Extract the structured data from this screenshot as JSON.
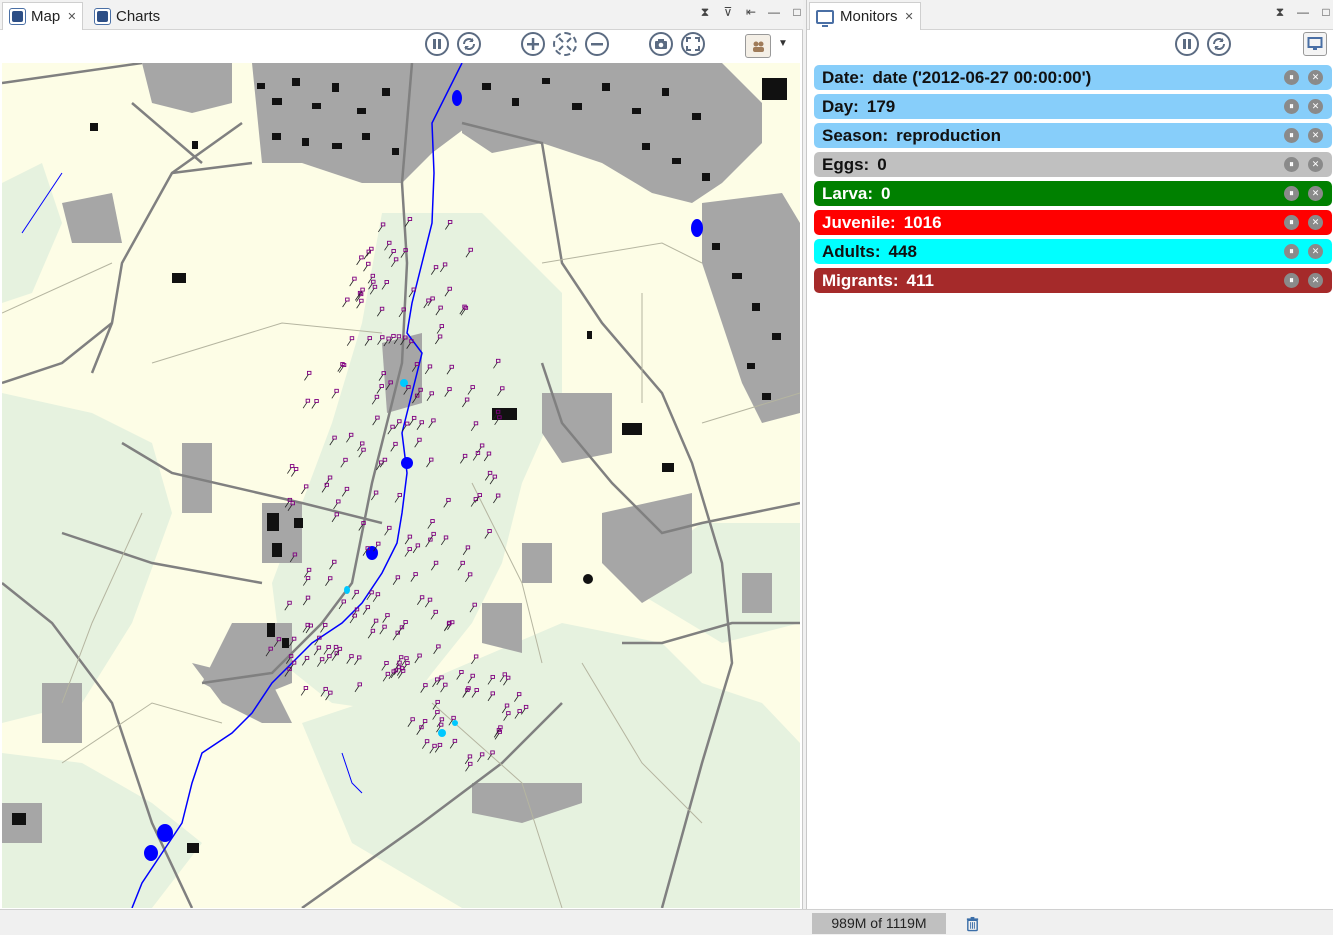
{
  "left_tabs": [
    {
      "label": "Map",
      "active": true,
      "closable": true
    },
    {
      "label": "Charts",
      "active": false,
      "closable": false
    }
  ],
  "right_tab": {
    "label": "Monitors"
  },
  "map_toolbar_icons": [
    "pause-icon",
    "sync-icon",
    "zoom-in-icon",
    "zoom-fit-icon",
    "zoom-out-icon",
    "camera-icon",
    "fullscreen-icon",
    "layers-icon"
  ],
  "monitors": [
    {
      "label": "Date:",
      "value": "date ('2012-06-27 00:00:00')",
      "bg": "#87cefa",
      "fg": "#111111"
    },
    {
      "label": "Day:",
      "value": "179",
      "bg": "#87cefa",
      "fg": "#111111"
    },
    {
      "label": "Season:",
      "value": "reproduction",
      "bg": "#87cefa",
      "fg": "#111111"
    },
    {
      "label": "Eggs:",
      "value": "0",
      "bg": "#c0c0c0",
      "fg": "#111111"
    },
    {
      "label": "Larva:",
      "value": "0",
      "bg": "#008000",
      "fg": "#ffffff"
    },
    {
      "label": "Juvenile:",
      "value": "1016",
      "bg": "#ff0000",
      "fg": "#ffffff"
    },
    {
      "label": "Adults:",
      "value": "448",
      "bg": "#00ffff",
      "fg": "#111111"
    },
    {
      "label": "Migrants:",
      "value": "411",
      "bg": "#a52a2a",
      "fg": "#ffffff"
    }
  ],
  "status": {
    "memory": "989M of 1119M"
  },
  "colors": {
    "land": "#fdfde6",
    "meadow": "#e6f2df",
    "built": "#a6a6a6",
    "road": "#808080",
    "river": "#0000ff",
    "agent": "#800080"
  }
}
